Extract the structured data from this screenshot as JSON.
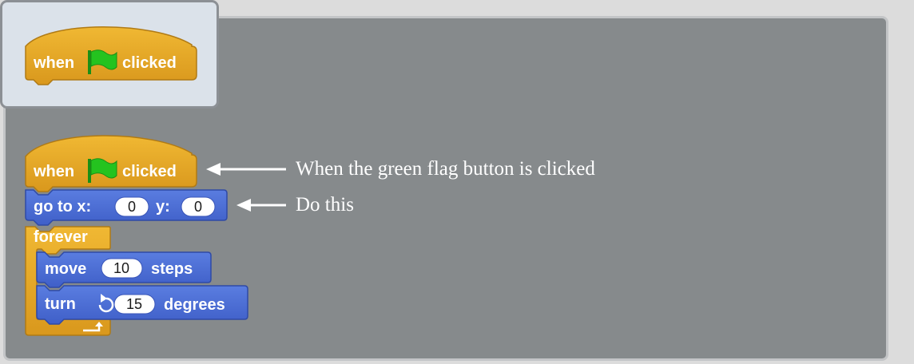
{
  "palette": {
    "hat_block": {
      "word1": "when",
      "word2": "clicked",
      "icon": "green-flag-icon"
    }
  },
  "script": {
    "hat_block": {
      "word1": "when",
      "word2": "clicked",
      "icon": "green-flag-icon"
    },
    "goto_block": {
      "label": "go to x:",
      "x_value": "0",
      "y_label": "y:",
      "y_value": "0"
    },
    "forever_block": {
      "label": "forever"
    },
    "move_block": {
      "label": "move",
      "value": "10",
      "unit": "steps"
    },
    "turn_block": {
      "label": "turn",
      "icon": "rotate-clockwise-icon",
      "value": "15",
      "unit": "degrees"
    }
  },
  "annotations": {
    "hat_note": "When the green flag button is clicked",
    "goto_note": "Do this"
  },
  "colors": {
    "control_block": "#e6a825",
    "motion_block": "#4a6cd4",
    "script_area": "#868a8c",
    "palette_bg": "#dbe2ea",
    "flag": "#24c31f"
  }
}
